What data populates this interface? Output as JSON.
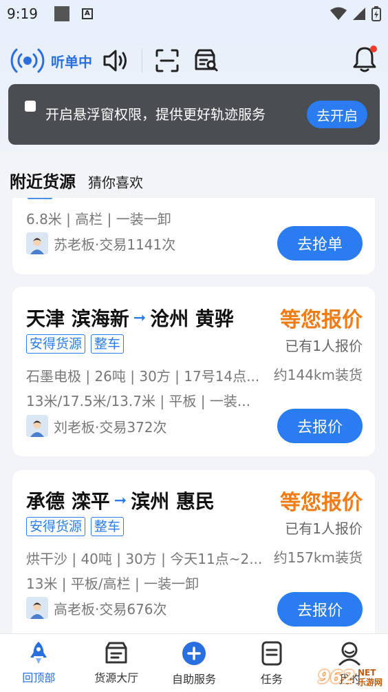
{
  "status_bar": {
    "time": "9:19"
  },
  "toolbar": {
    "listen_label": "听单中",
    "icons": [
      "radio-signal-icon",
      "speaker-icon",
      "scan-icon",
      "search-cargo-icon",
      "bell-icon"
    ]
  },
  "notice": {
    "text": "开启悬浮窗权限，提供更好轨迹服务",
    "button": "去开启"
  },
  "tabs": {
    "active": "附近货源",
    "other": "猜你喜欢"
  },
  "cards": [
    {
      "desc": "6.8米 | 高栏 | 一装一卸",
      "boss": "苏老板·交易1141次",
      "button": "去抢单"
    },
    {
      "from": "天津 滨海新",
      "to": "沧州 黄骅",
      "price": "等您报价",
      "quotes": "已有1人报价",
      "tags": [
        "安得货源",
        "整车"
      ],
      "desc1": "石墨电极 | 26吨 | 30方 | 17号14点...",
      "distance": "约144km装货",
      "desc2": "13米/17.5米/13.7米 | 平板 | 一装...",
      "boss": "刘老板·交易372次",
      "button": "去报价"
    },
    {
      "from": "承德 滦平",
      "to": "滨州 惠民",
      "price": "等您报价",
      "quotes": "已有1人报价",
      "tags": [
        "安得货源",
        "整车"
      ],
      "desc1": "烘干沙 | 40吨 | 30方 | 今天11点~2...",
      "distance": "约157km装货",
      "desc2": "13米 | 平板/高栏 | 一装一卸",
      "boss": "高老板·交易676次",
      "button": "去报价"
    }
  ],
  "bottom_nav": [
    {
      "label": "回顶部",
      "icon": "rocket-icon",
      "active": true
    },
    {
      "label": "货源大厅",
      "icon": "cargo-hall-icon",
      "active": false
    },
    {
      "label": "自助服务",
      "icon": "plus-circle-icon",
      "active": false
    },
    {
      "label": "任务",
      "icon": "task-list-icon",
      "active": false
    },
    {
      "label": "我的",
      "icon": "profile-icon",
      "active": false
    }
  ],
  "watermark": {
    "number": "962",
    "site": "NET",
    "sub": "乐游网"
  },
  "colors": {
    "accent": "#2a7cf0",
    "price": "#f07c16",
    "notice_bg": "#4a4d52"
  }
}
